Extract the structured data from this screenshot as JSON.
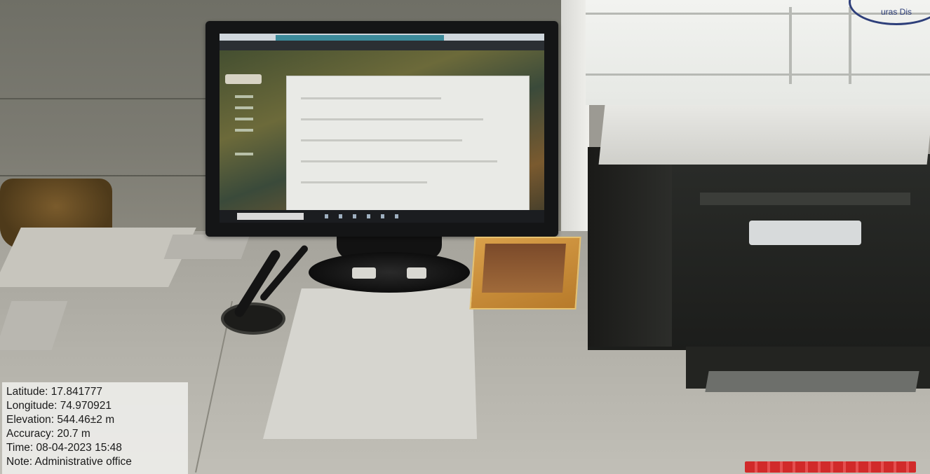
{
  "photo": {
    "stamp_text": "uras Dis",
    "overlay": {
      "latitude": "Latitude: 17.841777",
      "longitude": "Longitude: 74.970921",
      "elevation": "Elevation: 544.46±2 m",
      "accuracy": "Accuracy: 20.7 m",
      "time": "Time: 08-04-2023 15:48",
      "note": "Note: Administrative office"
    }
  }
}
